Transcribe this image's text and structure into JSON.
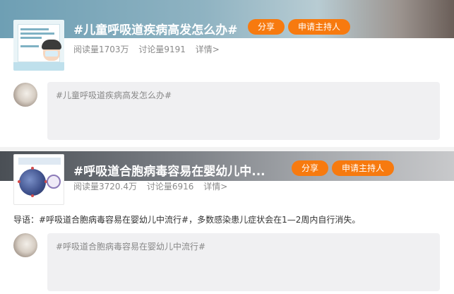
{
  "topics": [
    {
      "title": "#儿童呼吸道疾病高发怎么办#",
      "share_label": "分享",
      "apply_label": "申请主持人",
      "reads": "阅读量1703万",
      "discussions": "讨论量9191",
      "details": "详情>",
      "editor_text": "#儿童呼吸道疾病高发怎么办#"
    },
    {
      "title": "#呼吸道合胞病毒容易在婴幼儿中...",
      "share_label": "分享",
      "apply_label": "申请主持人",
      "reads": "阅读量3720.4万",
      "discussions": "讨论量6916",
      "details": "详情>",
      "lead": "导语：#呼吸道合胞病毒容易在婴幼儿中流行#，多数感染患儿症状会在1—2周内自行消失。",
      "editor_text": "#呼吸道合胞病毒容易在婴幼儿中流行#"
    }
  ],
  "colors": {
    "accent": "#f77a0f",
    "editor_bg": "#f0f0f2",
    "meta_text": "#8a8a8a"
  },
  "icons": {
    "thumb1": "children-respiratory-illustration",
    "thumb2": "virus-illustration",
    "avatar": "user-avatar"
  }
}
